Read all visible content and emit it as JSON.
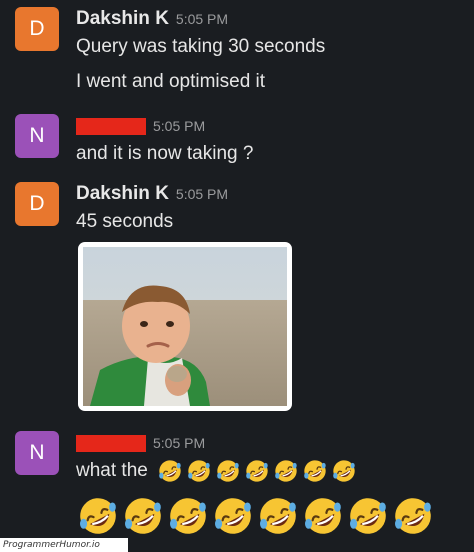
{
  "colors": {
    "background": "#1a1d21",
    "avatar_d": "#e8772e",
    "avatar_n": "#9b51b8",
    "redaction": "#e5271a",
    "emoji_face": "#f7c533",
    "tear": "#5dade2"
  },
  "messages": [
    {
      "avatar_letter": "D",
      "sender": "Dakshin K",
      "time": "5:05 PM",
      "lines": [
        "Query was taking 30 seconds",
        "I went and optimised it"
      ]
    },
    {
      "avatar_letter": "N",
      "sender_redacted": true,
      "time": "5:05 PM",
      "lines": [
        "and it is now taking ?"
      ]
    },
    {
      "avatar_letter": "D",
      "sender": "Dakshin K",
      "time": "5:05 PM",
      "lines": [
        "45 seconds"
      ],
      "attachment": "success-kid-meme-image"
    },
    {
      "avatar_letter": "N",
      "sender_redacted": true,
      "time": "5:05 PM",
      "text_prefix": "what the",
      "inline_emoji": "rolling-on-floor-laughing-icon",
      "inline_emoji_count": 7,
      "big_emoji": "rolling-on-floor-laughing-icon",
      "big_emoji_count": 8
    }
  ],
  "watermark": "ProgrammerHumor.io"
}
